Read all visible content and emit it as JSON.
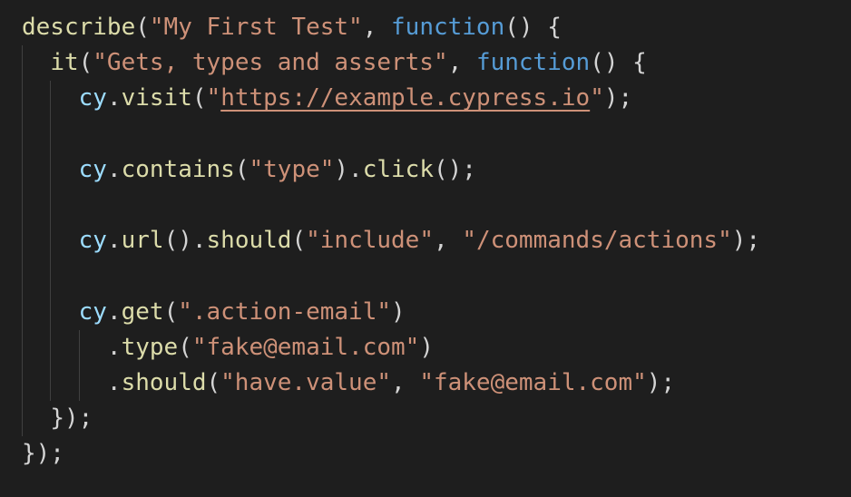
{
  "editor": {
    "lines": [
      {
        "indent": 0,
        "tokens": [
          {
            "t": "describe",
            "c": "fn"
          },
          {
            "t": "(",
            "c": "pun"
          },
          {
            "t": "\"My First Test\"",
            "c": "str"
          },
          {
            "t": ", ",
            "c": "pun"
          },
          {
            "t": "function",
            "c": "kw"
          },
          {
            "t": "() {",
            "c": "pun"
          }
        ]
      },
      {
        "indent": 1,
        "tokens": [
          {
            "t": "it",
            "c": "fn"
          },
          {
            "t": "(",
            "c": "pun"
          },
          {
            "t": "\"Gets, types and asserts\"",
            "c": "str"
          },
          {
            "t": ", ",
            "c": "pun"
          },
          {
            "t": "function",
            "c": "kw"
          },
          {
            "t": "() {",
            "c": "pun"
          }
        ]
      },
      {
        "indent": 2,
        "tokens": [
          {
            "t": "cy",
            "c": "var"
          },
          {
            "t": ".",
            "c": "pun"
          },
          {
            "t": "visit",
            "c": "fn"
          },
          {
            "t": "(",
            "c": "pun"
          },
          {
            "t": "\"",
            "c": "str"
          },
          {
            "t": "https://example.cypress.io",
            "c": "str url"
          },
          {
            "t": "\"",
            "c": "str"
          },
          {
            "t": ");",
            "c": "pun"
          }
        ]
      },
      {
        "indent": 0,
        "tokens": []
      },
      {
        "indent": 2,
        "tokens": [
          {
            "t": "cy",
            "c": "var"
          },
          {
            "t": ".",
            "c": "pun"
          },
          {
            "t": "contains",
            "c": "fn"
          },
          {
            "t": "(",
            "c": "pun"
          },
          {
            "t": "\"type\"",
            "c": "str"
          },
          {
            "t": ").",
            "c": "pun"
          },
          {
            "t": "click",
            "c": "fn"
          },
          {
            "t": "();",
            "c": "pun"
          }
        ]
      },
      {
        "indent": 0,
        "tokens": []
      },
      {
        "indent": 2,
        "tokens": [
          {
            "t": "cy",
            "c": "var"
          },
          {
            "t": ".",
            "c": "pun"
          },
          {
            "t": "url",
            "c": "fn"
          },
          {
            "t": "().",
            "c": "pun"
          },
          {
            "t": "should",
            "c": "fn"
          },
          {
            "t": "(",
            "c": "pun"
          },
          {
            "t": "\"include\"",
            "c": "str"
          },
          {
            "t": ", ",
            "c": "pun"
          },
          {
            "t": "\"/commands/actions\"",
            "c": "str"
          },
          {
            "t": ");",
            "c": "pun"
          }
        ]
      },
      {
        "indent": 0,
        "tokens": []
      },
      {
        "indent": 2,
        "tokens": [
          {
            "t": "cy",
            "c": "var"
          },
          {
            "t": ".",
            "c": "pun"
          },
          {
            "t": "get",
            "c": "fn"
          },
          {
            "t": "(",
            "c": "pun"
          },
          {
            "t": "\".action-email\"",
            "c": "str"
          },
          {
            "t": ")",
            "c": "pun"
          }
        ]
      },
      {
        "indent": 3,
        "tokens": [
          {
            "t": ".",
            "c": "pun"
          },
          {
            "t": "type",
            "c": "fn"
          },
          {
            "t": "(",
            "c": "pun"
          },
          {
            "t": "\"fake@email.com\"",
            "c": "str"
          },
          {
            "t": ")",
            "c": "pun"
          }
        ]
      },
      {
        "indent": 3,
        "tokens": [
          {
            "t": ".",
            "c": "pun"
          },
          {
            "t": "should",
            "c": "fn"
          },
          {
            "t": "(",
            "c": "pun"
          },
          {
            "t": "\"have.value\"",
            "c": "str"
          },
          {
            "t": ", ",
            "c": "pun"
          },
          {
            "t": "\"fake@email.com\"",
            "c": "str"
          },
          {
            "t": ");",
            "c": "pun"
          }
        ]
      },
      {
        "indent": 1,
        "tokens": [
          {
            "t": "});",
            "c": "pun"
          }
        ]
      },
      {
        "indent": 0,
        "tokens": [
          {
            "t": "});",
            "c": "pun"
          }
        ]
      }
    ]
  },
  "theme": {
    "background": "#1e1e1e",
    "function_color": "#dcdcaa",
    "keyword_color": "#569cd6",
    "string_color": "#ce9178",
    "variable_color": "#9cdcfe",
    "punctuation_color": "#d4d4d4",
    "indent_guide_color": "#404040"
  }
}
